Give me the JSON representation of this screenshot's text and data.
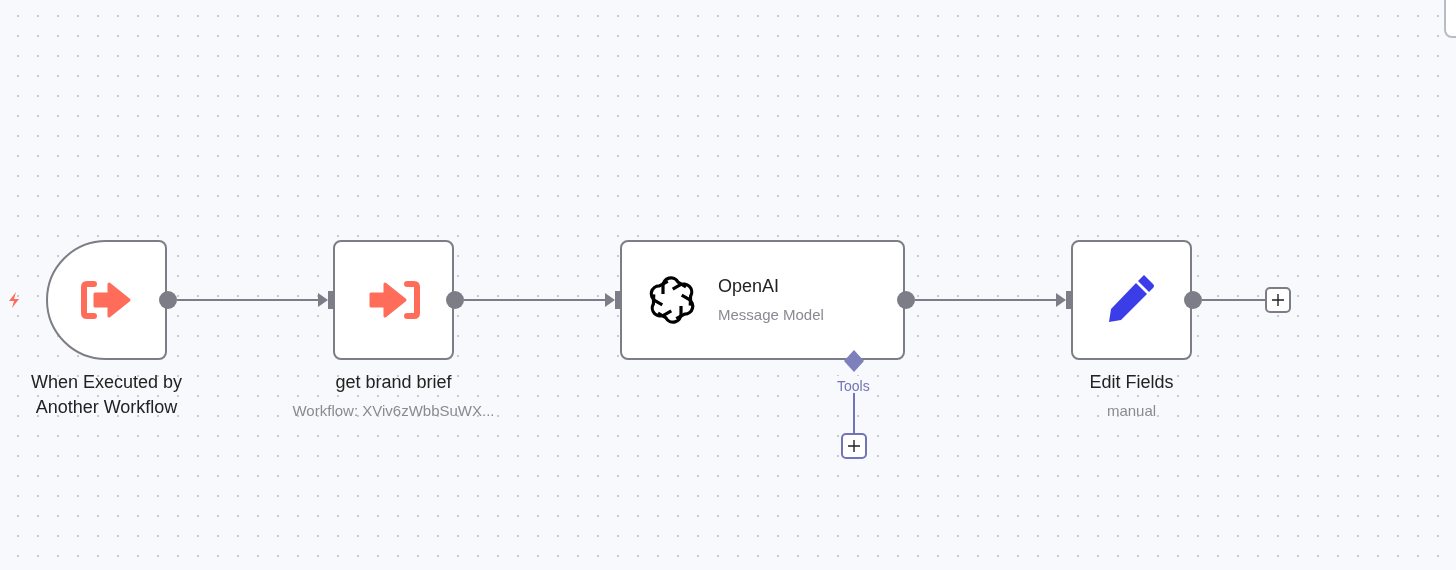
{
  "canvas": {
    "nodes": [
      {
        "kind": "trigger",
        "title": "When Executed by Another Workflow"
      },
      {
        "kind": "execute-workflow",
        "title": "get brand brief",
        "subtitle": "Workflow: XViv6zWbbSuWX..."
      },
      {
        "kind": "ai-model",
        "title": "OpenAI",
        "subtitle": "Message Model",
        "sub_port": {
          "label": "Tools"
        }
      },
      {
        "kind": "set",
        "title": "Edit Fields",
        "subtitle": "manual"
      }
    ]
  }
}
